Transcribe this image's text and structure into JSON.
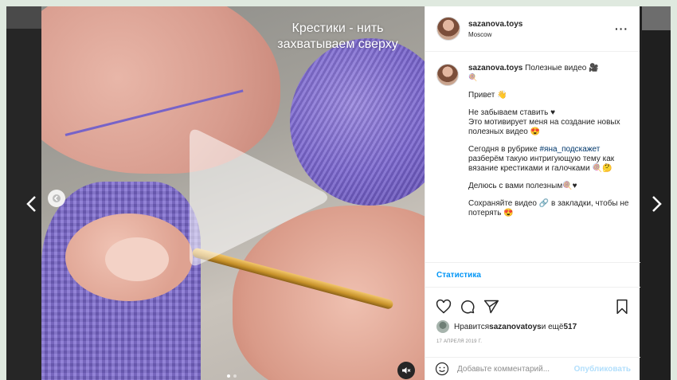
{
  "video": {
    "overlay_text_line1": "Крестики - нить",
    "overlay_text_line2": "захватываем сверху",
    "play_icon": "play-icon",
    "mute_icon": "muted-speaker-icon",
    "carousel_dots": 2,
    "carousel_active": 1
  },
  "nav": {
    "prev_icon": "chevron-left-icon",
    "next_icon": "chevron-right-icon"
  },
  "post": {
    "username": "sazanova.toys",
    "location": "Moscow",
    "more_icon": "more-dots-icon",
    "more_label": "···"
  },
  "caption": {
    "username": "sazanova.toys",
    "title": "Полезные видео 🎥",
    "title_emoji": "🍭",
    "greeting": "Привет 👋",
    "line1": "Не забываем ставить ♥",
    "line2": "Это мотивирует меня на создание новых полезных видео 😍",
    "rubric_before": "Сегодня в рубрике ",
    "hashtag": "#яна_подскажет",
    "rubric_after": " разберём такую интригующую тему как вязание крестиками и галочками 🍭🤔",
    "share": "Делюсь с вами полезным🍭♥",
    "save": "Сохраняйте видео 🔗 в закладки, чтобы не потерять 😍"
  },
  "stats_link": "Статистика",
  "actions": {
    "like_icon": "heart-icon",
    "comment_icon": "comment-icon",
    "share_icon": "send-icon",
    "save_icon": "bookmark-icon"
  },
  "likes": {
    "prefix": "Нравится ",
    "user": "sazanovatoys",
    "middle": " и ещё ",
    "count": "517"
  },
  "date": "17 АПРЕЛЯ 2019 Г.",
  "comment": {
    "placeholder": "Добавьте комментарий...",
    "publish_label": "Опубликовать",
    "emoji_icon": "smiley-icon"
  },
  "colors": {
    "link_blue": "#0095f6",
    "publish_disabled": "#b2dffc",
    "hashtag": "#00376b"
  }
}
